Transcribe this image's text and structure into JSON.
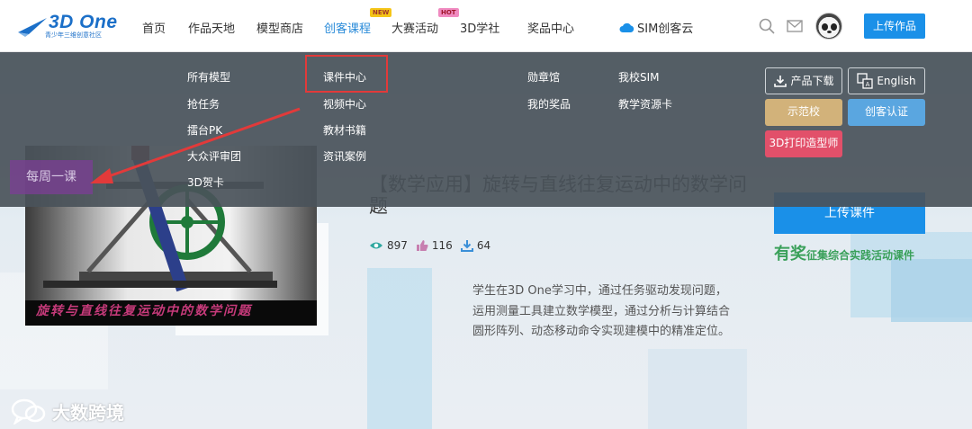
{
  "header": {
    "logo": {
      "name": "3D One",
      "tagline": "青少年三维创意社区"
    },
    "nav": [
      {
        "label": "首页"
      },
      {
        "label": "作品天地"
      },
      {
        "label": "模型商店"
      },
      {
        "label": "创客课程",
        "badge": "NEW"
      },
      {
        "label": "大赛活动",
        "badge": "HOT"
      },
      {
        "label": "3D学社"
      },
      {
        "label": "奖品中心"
      },
      {
        "label": "SIM创客云"
      }
    ],
    "icons": [
      "search-icon",
      "mail-icon"
    ],
    "upload_label": "上传作品"
  },
  "dropdown": {
    "col1": [
      "所有模型",
      "抢任务",
      "擂台PK",
      "大众评审团",
      "3D贺卡"
    ],
    "col2": [
      "课件中心",
      "视频中心",
      "教材书籍",
      "资讯案例"
    ],
    "col3": [
      "勋章馆",
      "我的奖品"
    ],
    "col4": [
      "我校SIM",
      "教学资源卡"
    ],
    "buttons": {
      "download": "产品下载",
      "english": "English",
      "demo_school": "示范校",
      "maker_cert": "创客认证",
      "print_designer": "3D打印造型师"
    }
  },
  "course": {
    "weekly_tab": "每周一课",
    "image_caption": "旋转与直线往复运动中的数学问题",
    "title": "【数学应用】旋转与直线往复运动中的数学问题",
    "views": "897",
    "likes": "116",
    "downloads": "64",
    "description": "学生在3D One学习中，通过任务驱动发现问题，运用测量工具建立数学模型，通过分析与计算结合圆形阵列、动态移动命令实现建模中的精准定位。",
    "upload_label": "上传课件",
    "promo_big": "有奖",
    "promo_small": "征集综合实践活动课件"
  },
  "watermark": "大数跨境",
  "colors": {
    "primary": "#1a90e8",
    "nav_active": "#2a8bd9",
    "highlight_red": "#e23a3a",
    "promo_green": "#3aa05a"
  }
}
